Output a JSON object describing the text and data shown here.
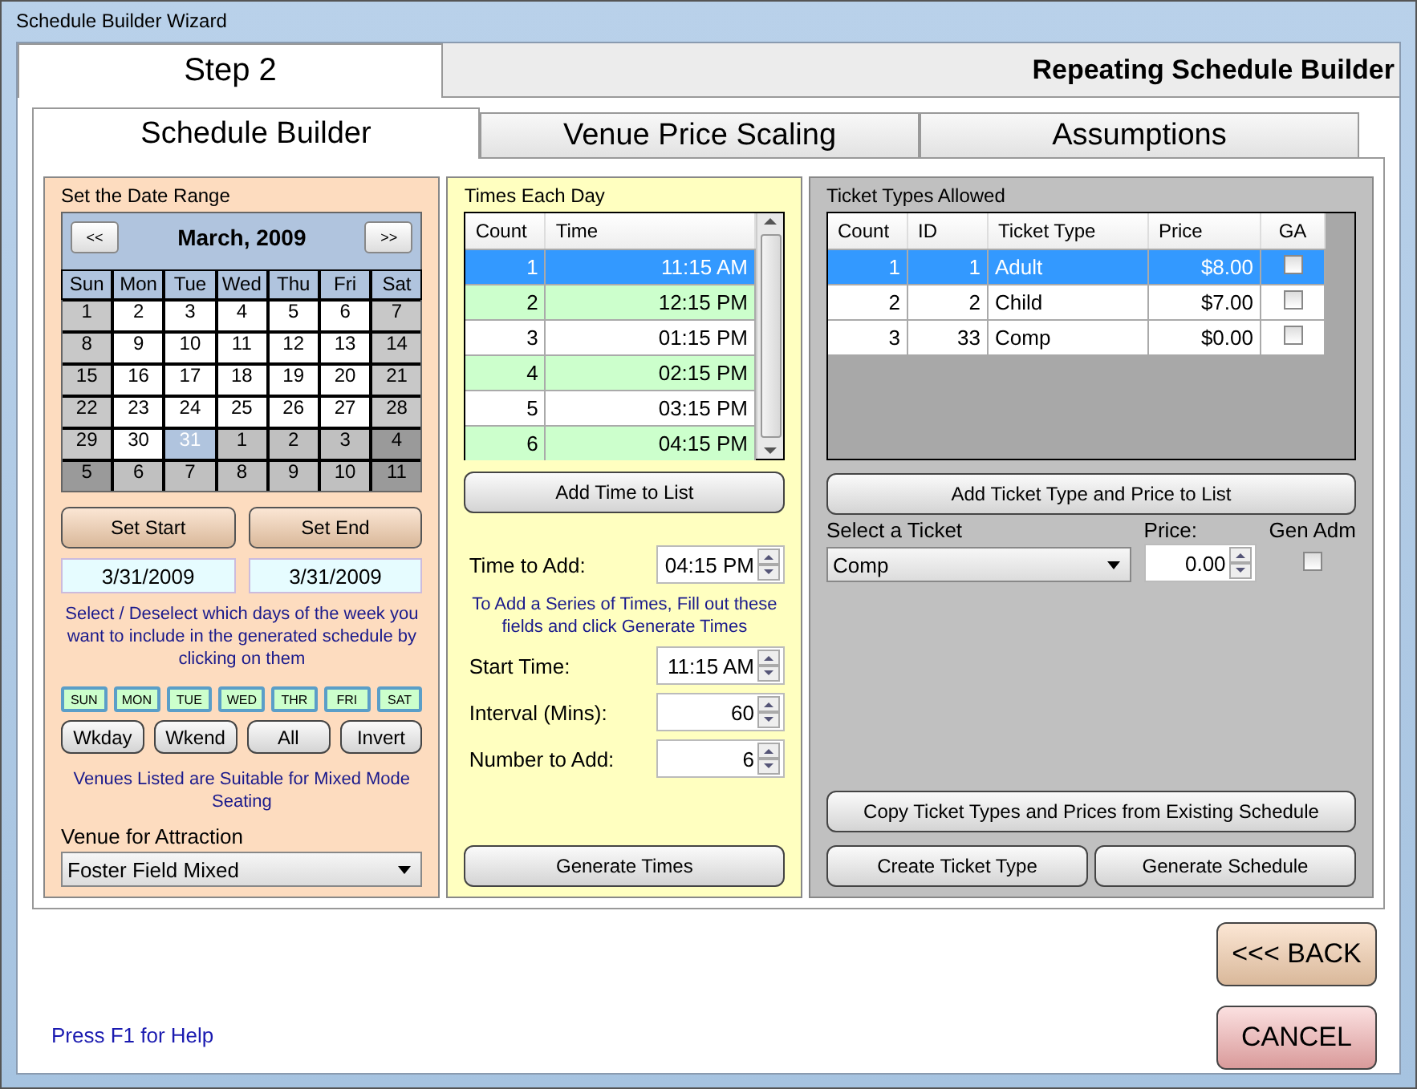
{
  "window": {
    "title": "Schedule Builder Wizard"
  },
  "steps": [
    {
      "label": "Step 2",
      "selected": true
    }
  ],
  "page_title": "Repeating Schedule Builder",
  "tabs": [
    {
      "label": "Schedule Builder",
      "selected": true
    },
    {
      "label": "Venue Price Scaling",
      "selected": false
    },
    {
      "label": "Assumptions",
      "selected": false
    }
  ],
  "date_range": {
    "title": "Set the Date Range",
    "prev": "<<",
    "next": ">>",
    "month": "March, 2009",
    "weekdays": [
      "Sun",
      "Mon",
      "Tue",
      "Wed",
      "Thu",
      "Fri",
      "Sat"
    ],
    "days": [
      {
        "label": "1",
        "kind": "weekend"
      },
      {
        "label": "2",
        "kind": "weekday"
      },
      {
        "label": "3",
        "kind": "weekday"
      },
      {
        "label": "4",
        "kind": "weekday"
      },
      {
        "label": "5",
        "kind": "weekday"
      },
      {
        "label": "6",
        "kind": "weekday"
      },
      {
        "label": "7",
        "kind": "weekend"
      },
      {
        "label": "8",
        "kind": "weekend"
      },
      {
        "label": "9",
        "kind": "weekday"
      },
      {
        "label": "10",
        "kind": "weekday"
      },
      {
        "label": "11",
        "kind": "weekday"
      },
      {
        "label": "12",
        "kind": "weekday"
      },
      {
        "label": "13",
        "kind": "weekday"
      },
      {
        "label": "14",
        "kind": "weekend"
      },
      {
        "label": "15",
        "kind": "weekend"
      },
      {
        "label": "16",
        "kind": "weekday"
      },
      {
        "label": "17",
        "kind": "weekday"
      },
      {
        "label": "18",
        "kind": "weekday"
      },
      {
        "label": "19",
        "kind": "weekday"
      },
      {
        "label": "20",
        "kind": "weekday"
      },
      {
        "label": "21",
        "kind": "weekend"
      },
      {
        "label": "22",
        "kind": "weekend"
      },
      {
        "label": "23",
        "kind": "weekday"
      },
      {
        "label": "24",
        "kind": "weekday"
      },
      {
        "label": "25",
        "kind": "weekday"
      },
      {
        "label": "26",
        "kind": "weekday"
      },
      {
        "label": "27",
        "kind": "weekday"
      },
      {
        "label": "28",
        "kind": "weekend"
      },
      {
        "label": "29",
        "kind": "weekend"
      },
      {
        "label": "30",
        "kind": "weekday"
      },
      {
        "label": "31",
        "kind": "selected"
      },
      {
        "label": "1",
        "kind": "other"
      },
      {
        "label": "2",
        "kind": "other"
      },
      {
        "label": "3",
        "kind": "other"
      },
      {
        "label": "4",
        "kind": "other_weekend"
      },
      {
        "label": "5",
        "kind": "other_weekend"
      },
      {
        "label": "6",
        "kind": "other"
      },
      {
        "label": "7",
        "kind": "other"
      },
      {
        "label": "8",
        "kind": "other"
      },
      {
        "label": "9",
        "kind": "other"
      },
      {
        "label": "10",
        "kind": "other"
      },
      {
        "label": "11",
        "kind": "other_weekend"
      }
    ],
    "set_start": "Set Start",
    "set_end": "Set End",
    "start_date": "3/31/2009",
    "end_date": "3/31/2009",
    "days_note": "Select / Deselect which days of the week you want to include in the generated schedule by clicking on them",
    "day_toggles": [
      {
        "label": "SUN",
        "selected": true
      },
      {
        "label": "MON",
        "selected": true
      },
      {
        "label": "TUE",
        "selected": true
      },
      {
        "label": "WED",
        "selected": true
      },
      {
        "label": "THR",
        "selected": true
      },
      {
        "label": "FRI",
        "selected": true
      },
      {
        "label": "SAT",
        "selected": true
      }
    ],
    "quick_buttons": [
      "Wkday",
      "Wkend",
      "All",
      "Invert"
    ],
    "venue_note": "Venues Listed are Suitable for Mixed Mode Seating",
    "venue_label": "Venue for Attraction",
    "venue": "Foster Field Mixed"
  },
  "times": {
    "title": "Times Each Day",
    "columns": [
      "Count",
      "Time"
    ],
    "rows": [
      {
        "count": "1",
        "time": "11:15 AM",
        "selected": true
      },
      {
        "count": "2",
        "time": "12:15 PM",
        "selected": false
      },
      {
        "count": "3",
        "time": "01:15 PM",
        "selected": false
      },
      {
        "count": "4",
        "time": "02:15 PM",
        "selected": false
      },
      {
        "count": "5",
        "time": "03:15 PM",
        "selected": false
      },
      {
        "count": "6",
        "time": "04:15 PM",
        "selected": false
      }
    ],
    "add_button": "Add Time to List",
    "time_to_add_label": "Time to Add:",
    "time_to_add": "04:15 PM",
    "series_note": "To Add a Series of Times, Fill out these fields and click Generate Times",
    "fields": [
      {
        "label": "Start Time:",
        "value": "11:15 AM"
      },
      {
        "label": "Interval (Mins):",
        "value": "60"
      },
      {
        "label": "Number to Add:",
        "value": "6"
      }
    ],
    "generate_button": "Generate Times"
  },
  "tickets": {
    "title": "Ticket Types Allowed",
    "columns": [
      "Count",
      "ID",
      "Ticket Type",
      "Price",
      "GA"
    ],
    "rows": [
      {
        "count": "1",
        "id": "1",
        "type": "Adult",
        "price": "$8.00",
        "ga": false,
        "selected": true
      },
      {
        "count": "2",
        "id": "2",
        "type": "Child",
        "price": "$7.00",
        "ga": false,
        "selected": false
      },
      {
        "count": "3",
        "id": "33",
        "type": "Comp",
        "price": "$0.00",
        "ga": false,
        "selected": false
      }
    ],
    "add_button": "Add Ticket Type and Price to List",
    "select_label": "Select a Ticket",
    "price_label": "Price:",
    "gen_adm_label": "Gen Adm",
    "ticket": "Comp",
    "price": "0.00",
    "gen_adm": false,
    "copy_button": "Copy Ticket Types and Prices from Existing Schedule",
    "create_button": "Create Ticket Type",
    "generate_button": "Generate Schedule"
  },
  "back_button": "<<< BACK",
  "cancel_button": "CANCEL",
  "help": "Press F1 for Help"
}
